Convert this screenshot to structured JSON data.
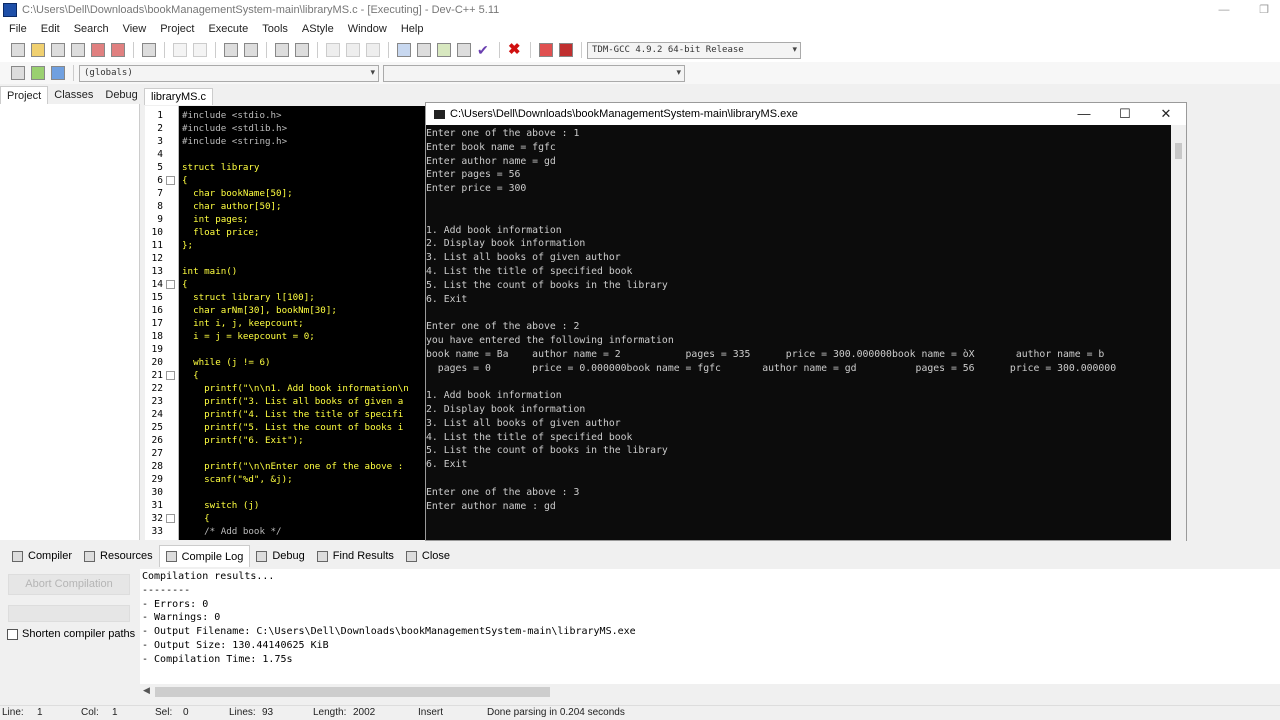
{
  "window": {
    "title": "C:\\Users\\Dell\\Downloads\\bookManagementSystem-main\\libraryMS.c - [Executing] - Dev-C++ 5.11"
  },
  "menu": [
    "File",
    "Edit",
    "Search",
    "View",
    "Project",
    "Execute",
    "Tools",
    "AStyle",
    "Window",
    "Help"
  ],
  "toolbar": {
    "compiler_select": "TDM-GCC 4.9.2 64-bit Release",
    "globals_select": "(globals)",
    "members_select": ""
  },
  "left_tabs": [
    "Project",
    "Classes",
    "Debug"
  ],
  "editor": {
    "file_tab": "libraryMS.c",
    "lines": [
      {
        "n": "1",
        "text": "#include <stdio.h>"
      },
      {
        "n": "2",
        "text": "#include <stdlib.h>"
      },
      {
        "n": "3",
        "text": "#include <string.h>"
      },
      {
        "n": "4",
        "text": ""
      },
      {
        "n": "5",
        "text": "struct library"
      },
      {
        "n": "6",
        "text": "{"
      },
      {
        "n": "7",
        "text": "  char bookName[50];"
      },
      {
        "n": "8",
        "text": "  char author[50];"
      },
      {
        "n": "9",
        "text": "  int pages;"
      },
      {
        "n": "10",
        "text": "  float price;"
      },
      {
        "n": "11",
        "text": "};"
      },
      {
        "n": "12",
        "text": ""
      },
      {
        "n": "13",
        "text": "int main()"
      },
      {
        "n": "14",
        "text": "{"
      },
      {
        "n": "15",
        "text": "  struct library l[100];"
      },
      {
        "n": "16",
        "text": "  char arNm[30], bookNm[30];"
      },
      {
        "n": "17",
        "text": "  int i, j, keepcount;"
      },
      {
        "n": "18",
        "text": "  i = j = keepcount = 0;"
      },
      {
        "n": "19",
        "text": ""
      },
      {
        "n": "20",
        "text": "  while (j != 6)"
      },
      {
        "n": "21",
        "text": "  {"
      },
      {
        "n": "22",
        "text": "    printf(\"\\n\\n1. Add book information\\n"
      },
      {
        "n": "23",
        "text": "    printf(\"3. List all books of given a"
      },
      {
        "n": "24",
        "text": "    printf(\"4. List the title of specifi"
      },
      {
        "n": "25",
        "text": "    printf(\"5. List the count of books i"
      },
      {
        "n": "26",
        "text": "    printf(\"6. Exit\");"
      },
      {
        "n": "27",
        "text": ""
      },
      {
        "n": "28",
        "text": "    printf(\"\\n\\nEnter one of the above :"
      },
      {
        "n": "29",
        "text": "    scanf(\"%d\", &j);"
      },
      {
        "n": "30",
        "text": ""
      },
      {
        "n": "31",
        "text": "    switch (j)"
      },
      {
        "n": "32",
        "text": "    {"
      },
      {
        "n": "33",
        "text": "    /* Add book */"
      }
    ]
  },
  "console": {
    "title": "C:\\Users\\Dell\\Downloads\\bookManagementSystem-main\\libraryMS.exe",
    "lines": [
      "Enter one of the above : 1",
      "Enter book name = fgfc",
      "Enter author name = gd",
      "Enter pages = 56",
      "Enter price = 300",
      "",
      "",
      "1. Add book information",
      "2. Display book information",
      "3. List all books of given author",
      "4. List the title of specified book",
      "5. List the count of books in the library",
      "6. Exit",
      "",
      "Enter one of the above : 2",
      "you have entered the following information",
      "book name = Ba    author name = 2           pages = 335      price = 300.000000book name = òX       author name = b",
      "  pages = 0       price = 0.000000book name = fgfc       author name = gd          pages = 56      price = 300.000000",
      "",
      "1. Add book information",
      "2. Display book information",
      "3. List all books of given author",
      "4. List the title of specified book",
      "5. List the count of books in the library",
      "6. Exit",
      "",
      "Enter one of the above : 3",
      "Enter author name : gd"
    ]
  },
  "bottom_tabs": [
    "Compiler",
    "Resources",
    "Compile Log",
    "Debug",
    "Find Results",
    "Close"
  ],
  "compile": {
    "abort_label": "Abort Compilation",
    "shorten_label": "Shorten compiler paths",
    "log": [
      "Compilation results...",
      "--------",
      "- Errors: 0",
      "- Warnings: 0",
      "- Output Filename: C:\\Users\\Dell\\Downloads\\bookManagementSystem-main\\libraryMS.exe",
      "- Output Size: 130.44140625 KiB",
      "- Compilation Time: 1.75s"
    ]
  },
  "status": {
    "line_label": "Line:",
    "line_value": "1",
    "col_label": "Col:",
    "col_value": "1",
    "sel_label": "Sel:",
    "sel_value": "0",
    "lines_label": "Lines:",
    "lines_value": "93",
    "length_label": "Length:",
    "length_value": "2002",
    "mode": "Insert",
    "message": "Done parsing in 0.204 seconds"
  }
}
